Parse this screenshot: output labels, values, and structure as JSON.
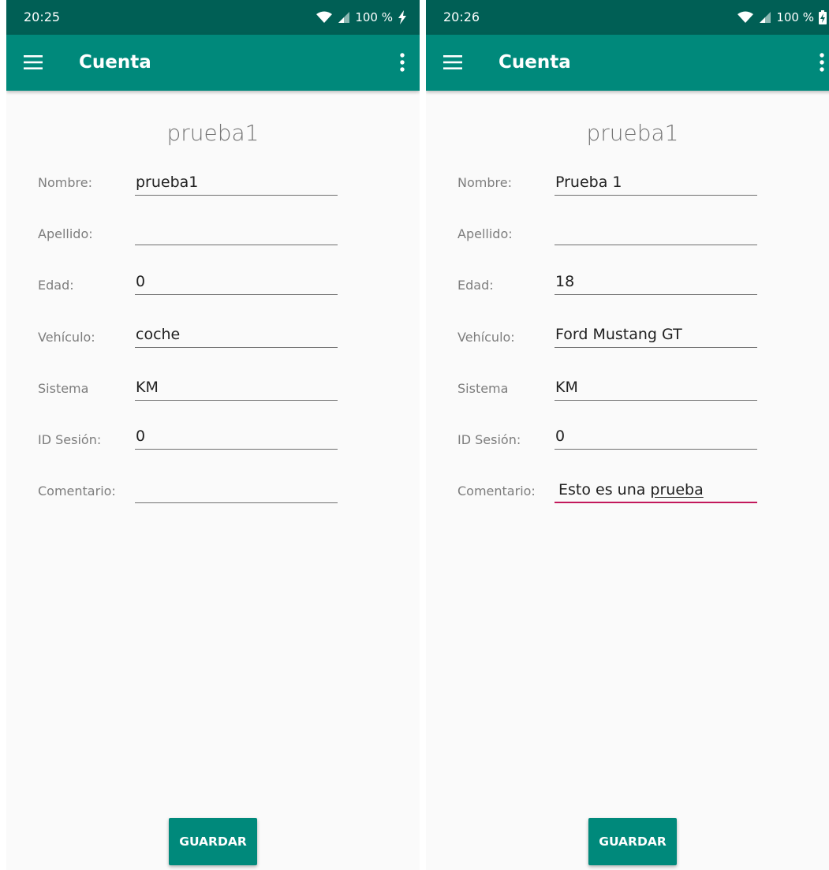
{
  "colors": {
    "status_bar": "#005f55",
    "app_bar": "#00897b",
    "button": "#00897b",
    "active_underline": "#c2185b"
  },
  "icons": {
    "menu": "hamburger-menu-icon",
    "overflow": "more-vertical-icon",
    "wifi": "wifi-icon",
    "signal": "cell-signal-icon",
    "charging": "charging-bolt-icon",
    "battery": "battery-charging-icon"
  },
  "screens": [
    {
      "status": {
        "time": "20:25",
        "battery": "100 %"
      },
      "appbar": {
        "title": "Cuenta"
      },
      "account_name": "prueba1",
      "labels": {
        "nombre": "Nombre:",
        "apellido": "Apellido:",
        "edad": "Edad:",
        "vehiculo": "Vehículo:",
        "sistema": "Sistema",
        "id_sesion": "ID Sesión:",
        "comentario": "Comentario:"
      },
      "values": {
        "nombre": "prueba1",
        "apellido": "",
        "edad": "0",
        "vehiculo": "coche",
        "sistema": "KM",
        "id_sesion": "0",
        "comentario": ""
      },
      "save_label": "GUARDAR"
    },
    {
      "status": {
        "time": "20:26",
        "battery": "100 %"
      },
      "appbar": {
        "title": "Cuenta"
      },
      "account_name": "prueba1",
      "labels": {
        "nombre": "Nombre:",
        "apellido": "Apellido:",
        "edad": "Edad:",
        "vehiculo": "Vehículo:",
        "sistema": "Sistema",
        "id_sesion": "ID Sesión:",
        "comentario": "Comentario:"
      },
      "values": {
        "nombre": "Prueba 1",
        "apellido": "",
        "edad": "18",
        "vehiculo": "Ford Mustang GT",
        "sistema": "KM",
        "id_sesion": "0",
        "comentario_prefix": "Esto es una ",
        "comentario_underlined": "prueba"
      },
      "save_label": "GUARDAR"
    }
  ]
}
